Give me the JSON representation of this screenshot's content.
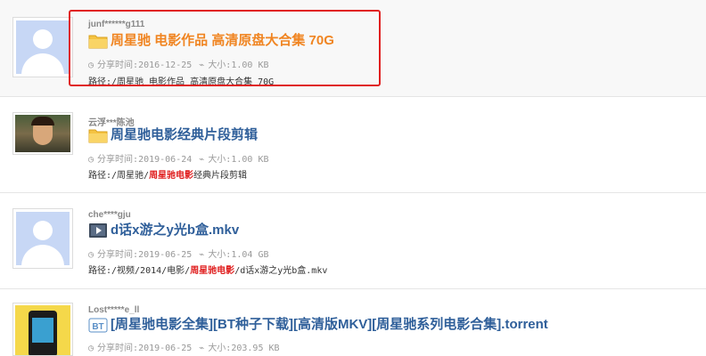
{
  "results": [
    {
      "user": "junf******g111",
      "title": "周星驰 电影作品 高清原盘大合集 70G",
      "type": "folder",
      "share_label": "分享时间:",
      "share_time": "2016-12-25",
      "size_label": "大小:",
      "size": "1.00 KB",
      "path_prefix": "路径:/周星驰 电影作品 高清原盘大合集 70G",
      "path_highlight": "",
      "path_suffix": ""
    },
    {
      "user": "云浮***陈池",
      "title": "周星驰电影经典片段剪辑",
      "type": "folder",
      "share_label": "分享时间:",
      "share_time": "2019-06-24",
      "size_label": "大小:",
      "size": "1.00 KB",
      "path_prefix": "路径:/周星驰/",
      "path_highlight": "周星驰电影",
      "path_suffix": "经典片段剪辑"
    },
    {
      "user": "che****gju",
      "title": "d话x游之y光b盒.mkv",
      "type": "video",
      "share_label": "分享时间:",
      "share_time": "2019-06-25",
      "size_label": "大小:",
      "size": "1.04 GB",
      "path_prefix": "路径:/视频/2014/电影/",
      "path_highlight": "周星驰电影",
      "path_suffix": "/d话x游之y光b盒.mkv"
    },
    {
      "user": "Lost*****e_ll",
      "title": "[周星驰电影全集][BT种子下载][高清版MKV][周星驰系列电影合集].torrent",
      "type": "torrent",
      "share_label": "分享时间:",
      "share_time": "2019-06-25",
      "size_label": "大小:",
      "size": "203.95 KB",
      "path_prefix": "",
      "path_highlight": "",
      "path_suffix": ""
    }
  ],
  "icons": {
    "clock": "clock-icon",
    "size": "tag-icon",
    "folder": "folder-icon",
    "video": "video-file-icon",
    "torrent": "bt-torrent-icon"
  },
  "colors": {
    "link": "#2f5f9a",
    "highlight_title": "#f08522",
    "keyword": "#e02020",
    "selection_box": "#e02020"
  }
}
